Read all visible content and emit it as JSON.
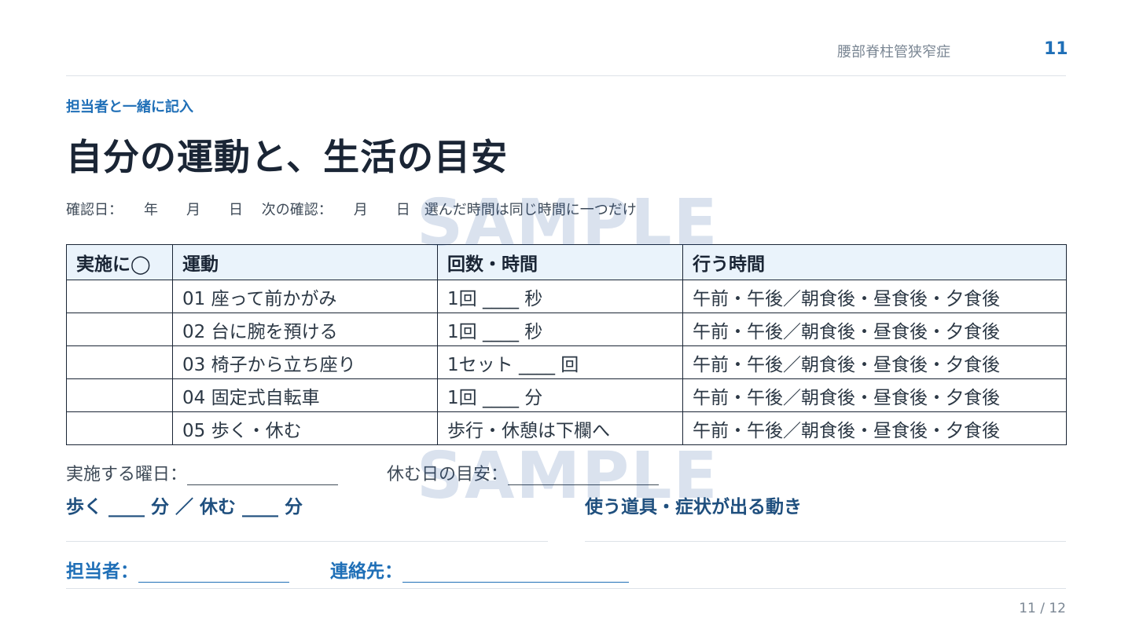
{
  "header": {
    "topic": "腰部脊柱管狭窄症",
    "page_number": "11"
  },
  "eyebrow": "担当者と一緒に記入",
  "title": "自分の運動と、生活の目安",
  "meta_line": "確認日：　　年　　月　　日　 次の確認：　　月　　日　選んだ時間は同じ時間に一つだけ",
  "watermark": "SAMPLE",
  "table": {
    "headers": [
      "実施に◯",
      "運動",
      "回数・時間",
      "行う時間"
    ],
    "rows": [
      [
        "",
        "01 座って前かがみ",
        "1回 ____ 秒",
        "午前・午後／朝食後・昼食後・夕食後"
      ],
      [
        "",
        "02 台に腕を預ける",
        "1回 ____ 秒",
        "午前・午後／朝食後・昼食後・夕食後"
      ],
      [
        "",
        "03 椅子から立ち座り",
        "1セット ____ 回",
        "午前・午後／朝食後・昼食後・夕食後"
      ],
      [
        "",
        "04 固定式自転車",
        "1回 ____ 分",
        "午前・午後／朝食後・昼食後・夕食後"
      ],
      [
        "",
        "05 歩く・休む",
        "歩行・休憩は下欄へ",
        "午前・午後／朝食後・昼食後・夕食後"
      ]
    ]
  },
  "fields": {
    "weekdays_label": "実施する曜日：",
    "rest_label": "休む日の目安：",
    "walk_rest": "歩く ____ 分 ／ 休む ____ 分",
    "tools": "使う道具・症状が出る動き",
    "staff_label": "担当者：",
    "contact_label": "連絡先："
  },
  "footer": {
    "pagination": "11 / 12"
  },
  "colors": {
    "accent": "#1f6fb7",
    "heading": "#1a2535",
    "header_fill": "#eaf3fb",
    "muted": "#7b8794"
  }
}
